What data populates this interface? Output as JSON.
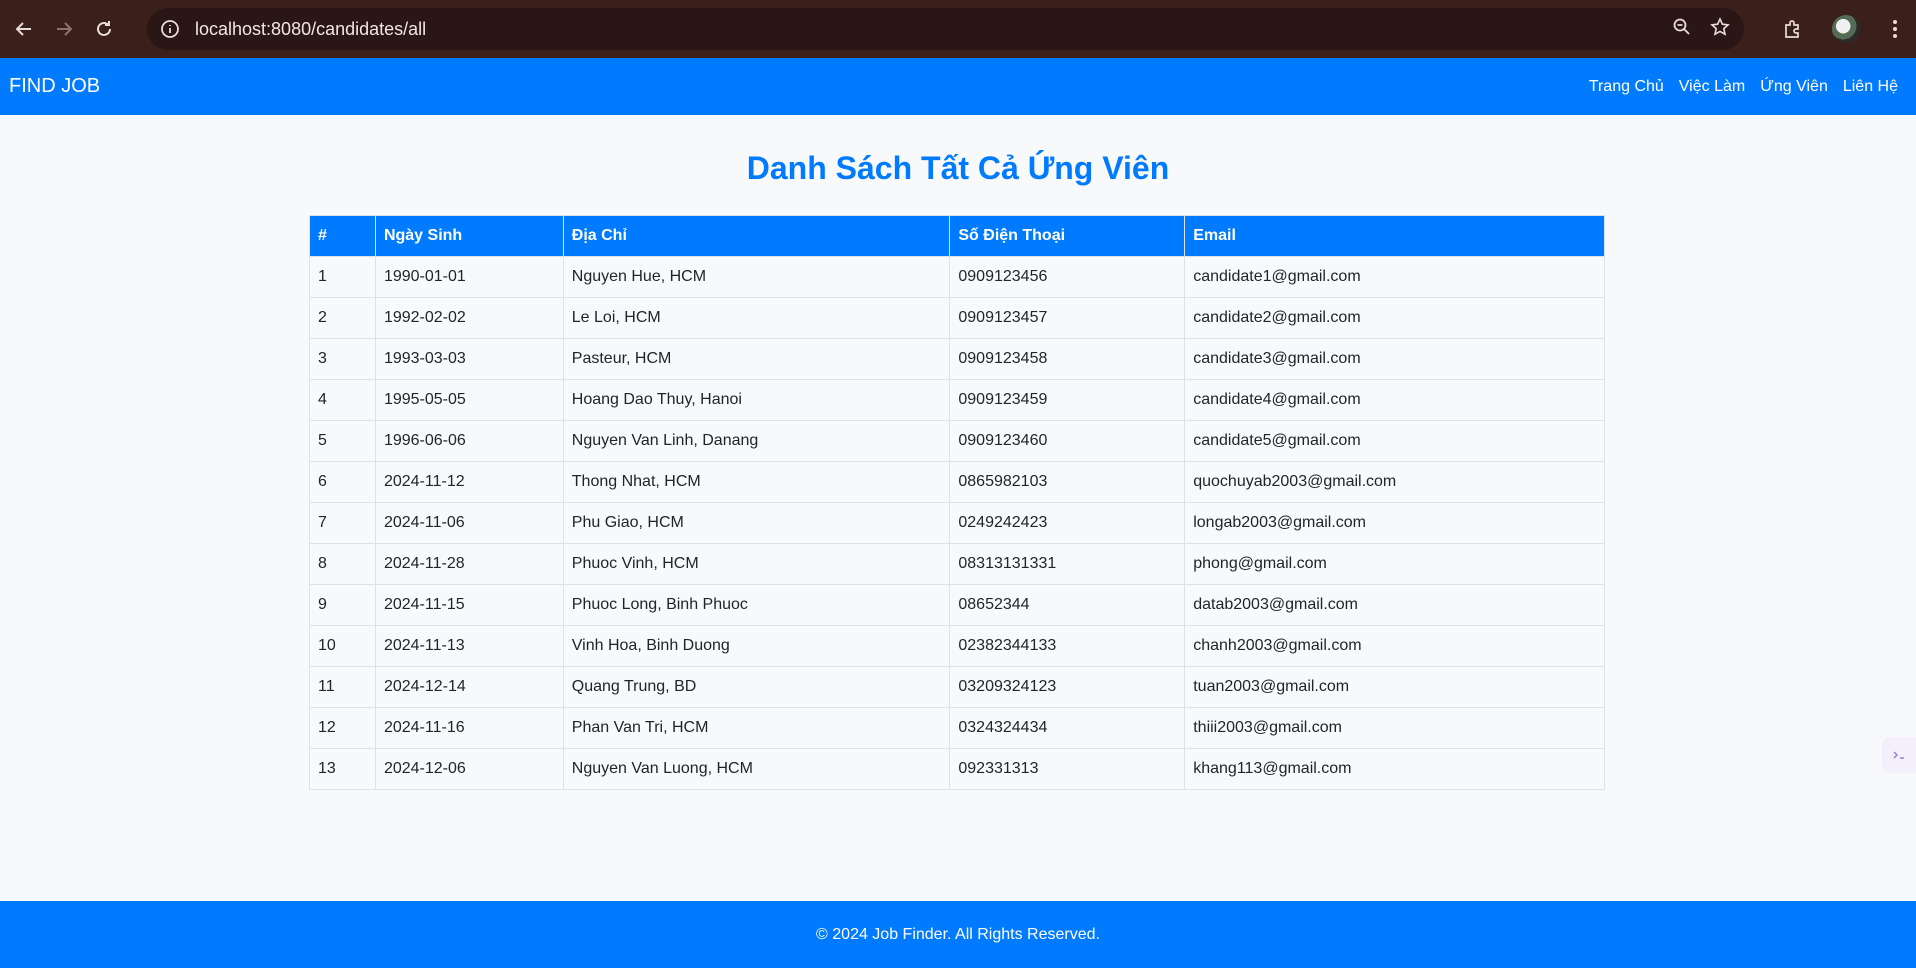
{
  "browser": {
    "url": "localhost:8080/candidates/all"
  },
  "site": {
    "brand": "FIND JOB",
    "nav": [
      {
        "label": "Trang Chủ"
      },
      {
        "label": "Việc Làm"
      },
      {
        "label": "Ứng Viên"
      },
      {
        "label": "Liên Hệ"
      }
    ]
  },
  "main": {
    "title": "Danh Sách Tất Cả Ứng Viên",
    "table": {
      "headers": [
        "#",
        "Ngày Sinh",
        "Địa Chỉ",
        "Số Điện Thoại",
        "Email"
      ],
      "rows": [
        [
          "1",
          "1990-01-01",
          "Nguyen Hue, HCM",
          "0909123456",
          "candidate1@gmail.com"
        ],
        [
          "2",
          "1992-02-02",
          "Le Loi, HCM",
          "0909123457",
          "candidate2@gmail.com"
        ],
        [
          "3",
          "1993-03-03",
          "Pasteur, HCM",
          "0909123458",
          "candidate3@gmail.com"
        ],
        [
          "4",
          "1995-05-05",
          "Hoang Dao Thuy, Hanoi",
          "0909123459",
          "candidate4@gmail.com"
        ],
        [
          "5",
          "1996-06-06",
          "Nguyen Van Linh, Danang",
          "0909123460",
          "candidate5@gmail.com"
        ],
        [
          "6",
          "2024-11-12",
          "Thong Nhat, HCM",
          "0865982103",
          "quochuyab2003@gmail.com"
        ],
        [
          "7",
          "2024-11-06",
          "Phu Giao, HCM",
          "0249242423",
          "longab2003@gmail.com"
        ],
        [
          "8",
          "2024-11-28",
          "Phuoc Vinh, HCM",
          "08313131331",
          "phong@gmail.com"
        ],
        [
          "9",
          "2024-11-15",
          "Phuoc Long, Binh Phuoc",
          "08652344",
          "datab2003@gmail.com"
        ],
        [
          "10",
          "2024-11-13",
          "Vinh Hoa, Binh Duong",
          "02382344133",
          "chanh2003@gmail.com"
        ],
        [
          "11",
          "2024-12-14",
          "Quang Trung, BD",
          "03209324123",
          "tuan2003@gmail.com"
        ],
        [
          "12",
          "2024-11-16",
          "Phan Van Tri, HCM",
          "0324324434",
          "thiii2003@gmail.com"
        ],
        [
          "13",
          "2024-12-06",
          "Nguyen Van Luong, HCM",
          "092331313",
          "khang113@gmail.com"
        ]
      ]
    }
  },
  "footer": {
    "text": "© 2024 Job Finder. All Rights Reserved."
  },
  "colors": {
    "primary": "#007bff",
    "browser_frame": "#3a1f1b",
    "page_bg": "#f8f9fa"
  },
  "icons": [
    "back-arrow-icon",
    "forward-arrow-icon",
    "reload-icon",
    "site-info-icon",
    "zoom-icon",
    "bookmark-star-icon",
    "extensions-icon",
    "profile-avatar",
    "menu-kebab-icon"
  ]
}
